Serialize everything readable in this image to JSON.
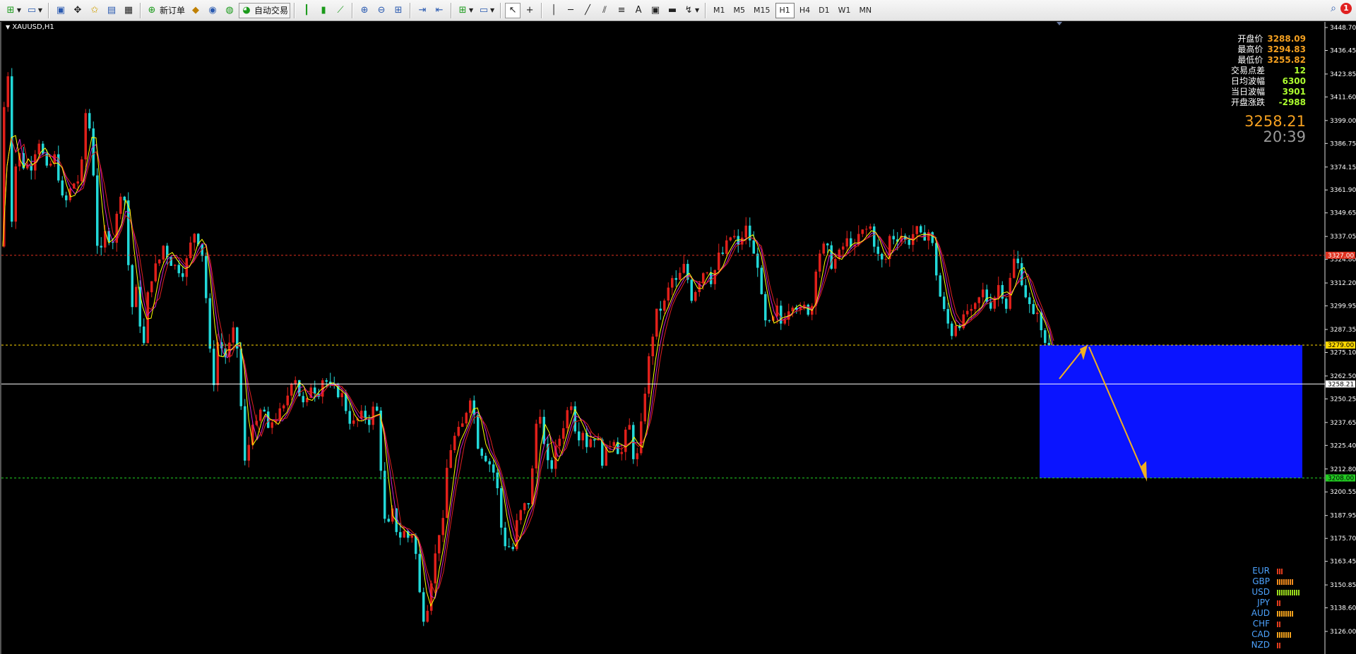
{
  "toolbar": {
    "new_order_label": "新订单",
    "auto_trade_label": "自动交易",
    "timeframes": [
      "M1",
      "M5",
      "M15",
      "H1",
      "H4",
      "D1",
      "W1",
      "MN"
    ],
    "active_timeframe": "H1",
    "notification_count": "1"
  },
  "chart": {
    "symbol": "XAUUSD,H1",
    "current_price": "3258.21",
    "countdown": "20:39",
    "info_panel": [
      {
        "label": "开盘价",
        "value": "3288.09",
        "color": "#f4a020"
      },
      {
        "label": "最高价",
        "value": "3294.83",
        "color": "#f4a020"
      },
      {
        "label": "最低价",
        "value": "3255.82",
        "color": "#f4a020"
      },
      {
        "label": "交易点差",
        "value": "12",
        "color": "#adff2f"
      },
      {
        "label": "日均波幅",
        "value": "6300",
        "color": "#adff2f"
      },
      {
        "label": "当日波幅",
        "value": "3901",
        "color": "#adff2f"
      },
      {
        "label": "开盘涨跌",
        "value": "-2988",
        "color": "#adff2f"
      }
    ],
    "price_axis": [
      "3448.70",
      "3436.45",
      "3423.85",
      "3411.60",
      "3399.00",
      "3386.75",
      "3374.15",
      "3361.90",
      "3349.65",
      "3337.05",
      "3324.80",
      "3312.20",
      "3299.95",
      "3287.35",
      "3275.10",
      "3262.50",
      "3250.25",
      "3237.65",
      "3225.40",
      "3212.80",
      "3200.55",
      "3187.95",
      "3175.70",
      "3163.45",
      "3150.85",
      "3138.60",
      "3126.00"
    ],
    "levels": {
      "red": {
        "label": "3327.00",
        "color": "#e0301e"
      },
      "yellow": {
        "label": "3279.00",
        "color": "#ffd800"
      },
      "current": {
        "label": "3258.21",
        "color": "#ffffff"
      },
      "green": {
        "label": "3208.00",
        "color": "#22cc22"
      }
    },
    "colors": {
      "bull": "#e0201a",
      "bear": "#22d8d8",
      "ma_fast": "#ffff00",
      "ma_mid": "#e02020",
      "ma_slow": "#d020d0",
      "zone": "#0a14ff",
      "arrow": "#f0b020"
    }
  },
  "currencies": [
    {
      "name": "EUR",
      "strength": 3,
      "color": "#e03c1c"
    },
    {
      "name": "GBP",
      "strength": 8,
      "color": "#f08a1c"
    },
    {
      "name": "USD",
      "strength": 11,
      "color": "#9adc1c"
    },
    {
      "name": "JPY",
      "strength": 2,
      "color": "#e03c1c"
    },
    {
      "name": "AUD",
      "strength": 8,
      "color": "#f0a01c"
    },
    {
      "name": "CHF",
      "strength": 2,
      "color": "#e03c1c"
    },
    {
      "name": "CAD",
      "strength": 7,
      "color": "#f0a01c"
    },
    {
      "name": "NZD",
      "strength": 2,
      "color": "#e03c1c"
    }
  ]
}
